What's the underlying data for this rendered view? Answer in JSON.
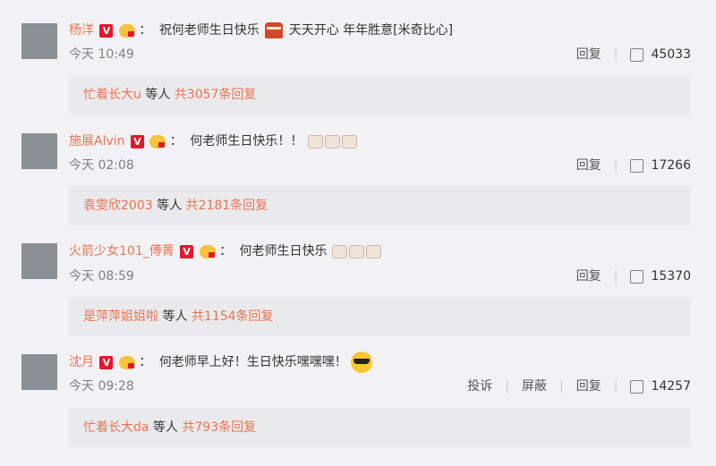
{
  "comments": [
    {
      "user": "杨洋",
      "text1": "祝何老师生日快乐",
      "text2": "天天开心  年年胜意[米奇比心]",
      "time": "今天 10:49",
      "actions": [
        "回复"
      ],
      "likes": "45033",
      "reply_user": "忙着长大u",
      "reply_mid": " 等人 ",
      "reply_total": "共3057条回复"
    },
    {
      "user": "施展Alvin",
      "text1": "何老师生日快乐！！",
      "text2": "",
      "time": "今天 02:08",
      "actions": [
        "回复"
      ],
      "likes": "17266",
      "reply_user": "袁雯欣2003",
      "reply_mid": " 等人 ",
      "reply_total": "共2181条回复"
    },
    {
      "user": "火箭少女101_傅菁",
      "text1": "何老师生日快乐",
      "text2": "",
      "time": "今天 08:59",
      "actions": [
        "回复"
      ],
      "likes": "15370",
      "reply_user": "是萍萍姐姐啦",
      "reply_mid": " 等人 ",
      "reply_total": "共1154条回复"
    },
    {
      "user": "沈月",
      "text1": "何老师早上好！生日快乐嘿嘿嘿！",
      "text2": "",
      "time": "今天 09:28",
      "actions": [
        "投诉",
        "屏蔽",
        "回复"
      ],
      "likes": "14257",
      "reply_user": "忙着长大da",
      "reply_mid": " 等人 ",
      "reply_total": "共793条回复"
    }
  ],
  "badge": {
    "v_letter": "V",
    "colon": "："
  },
  "icons": {
    "verified": "verified-v-icon",
    "fan": "fan-badge-icon",
    "cake": "birthday-cake-emoji",
    "small_cake": "small-cake-emoji",
    "sunglasses": "sunglasses-emoji",
    "like": "thumbs-up-icon"
  },
  "colors": {
    "username": "#eb7350",
    "verified": "#e6162d",
    "background": "#f2f2f5",
    "reply_box": "#eaeaec"
  }
}
